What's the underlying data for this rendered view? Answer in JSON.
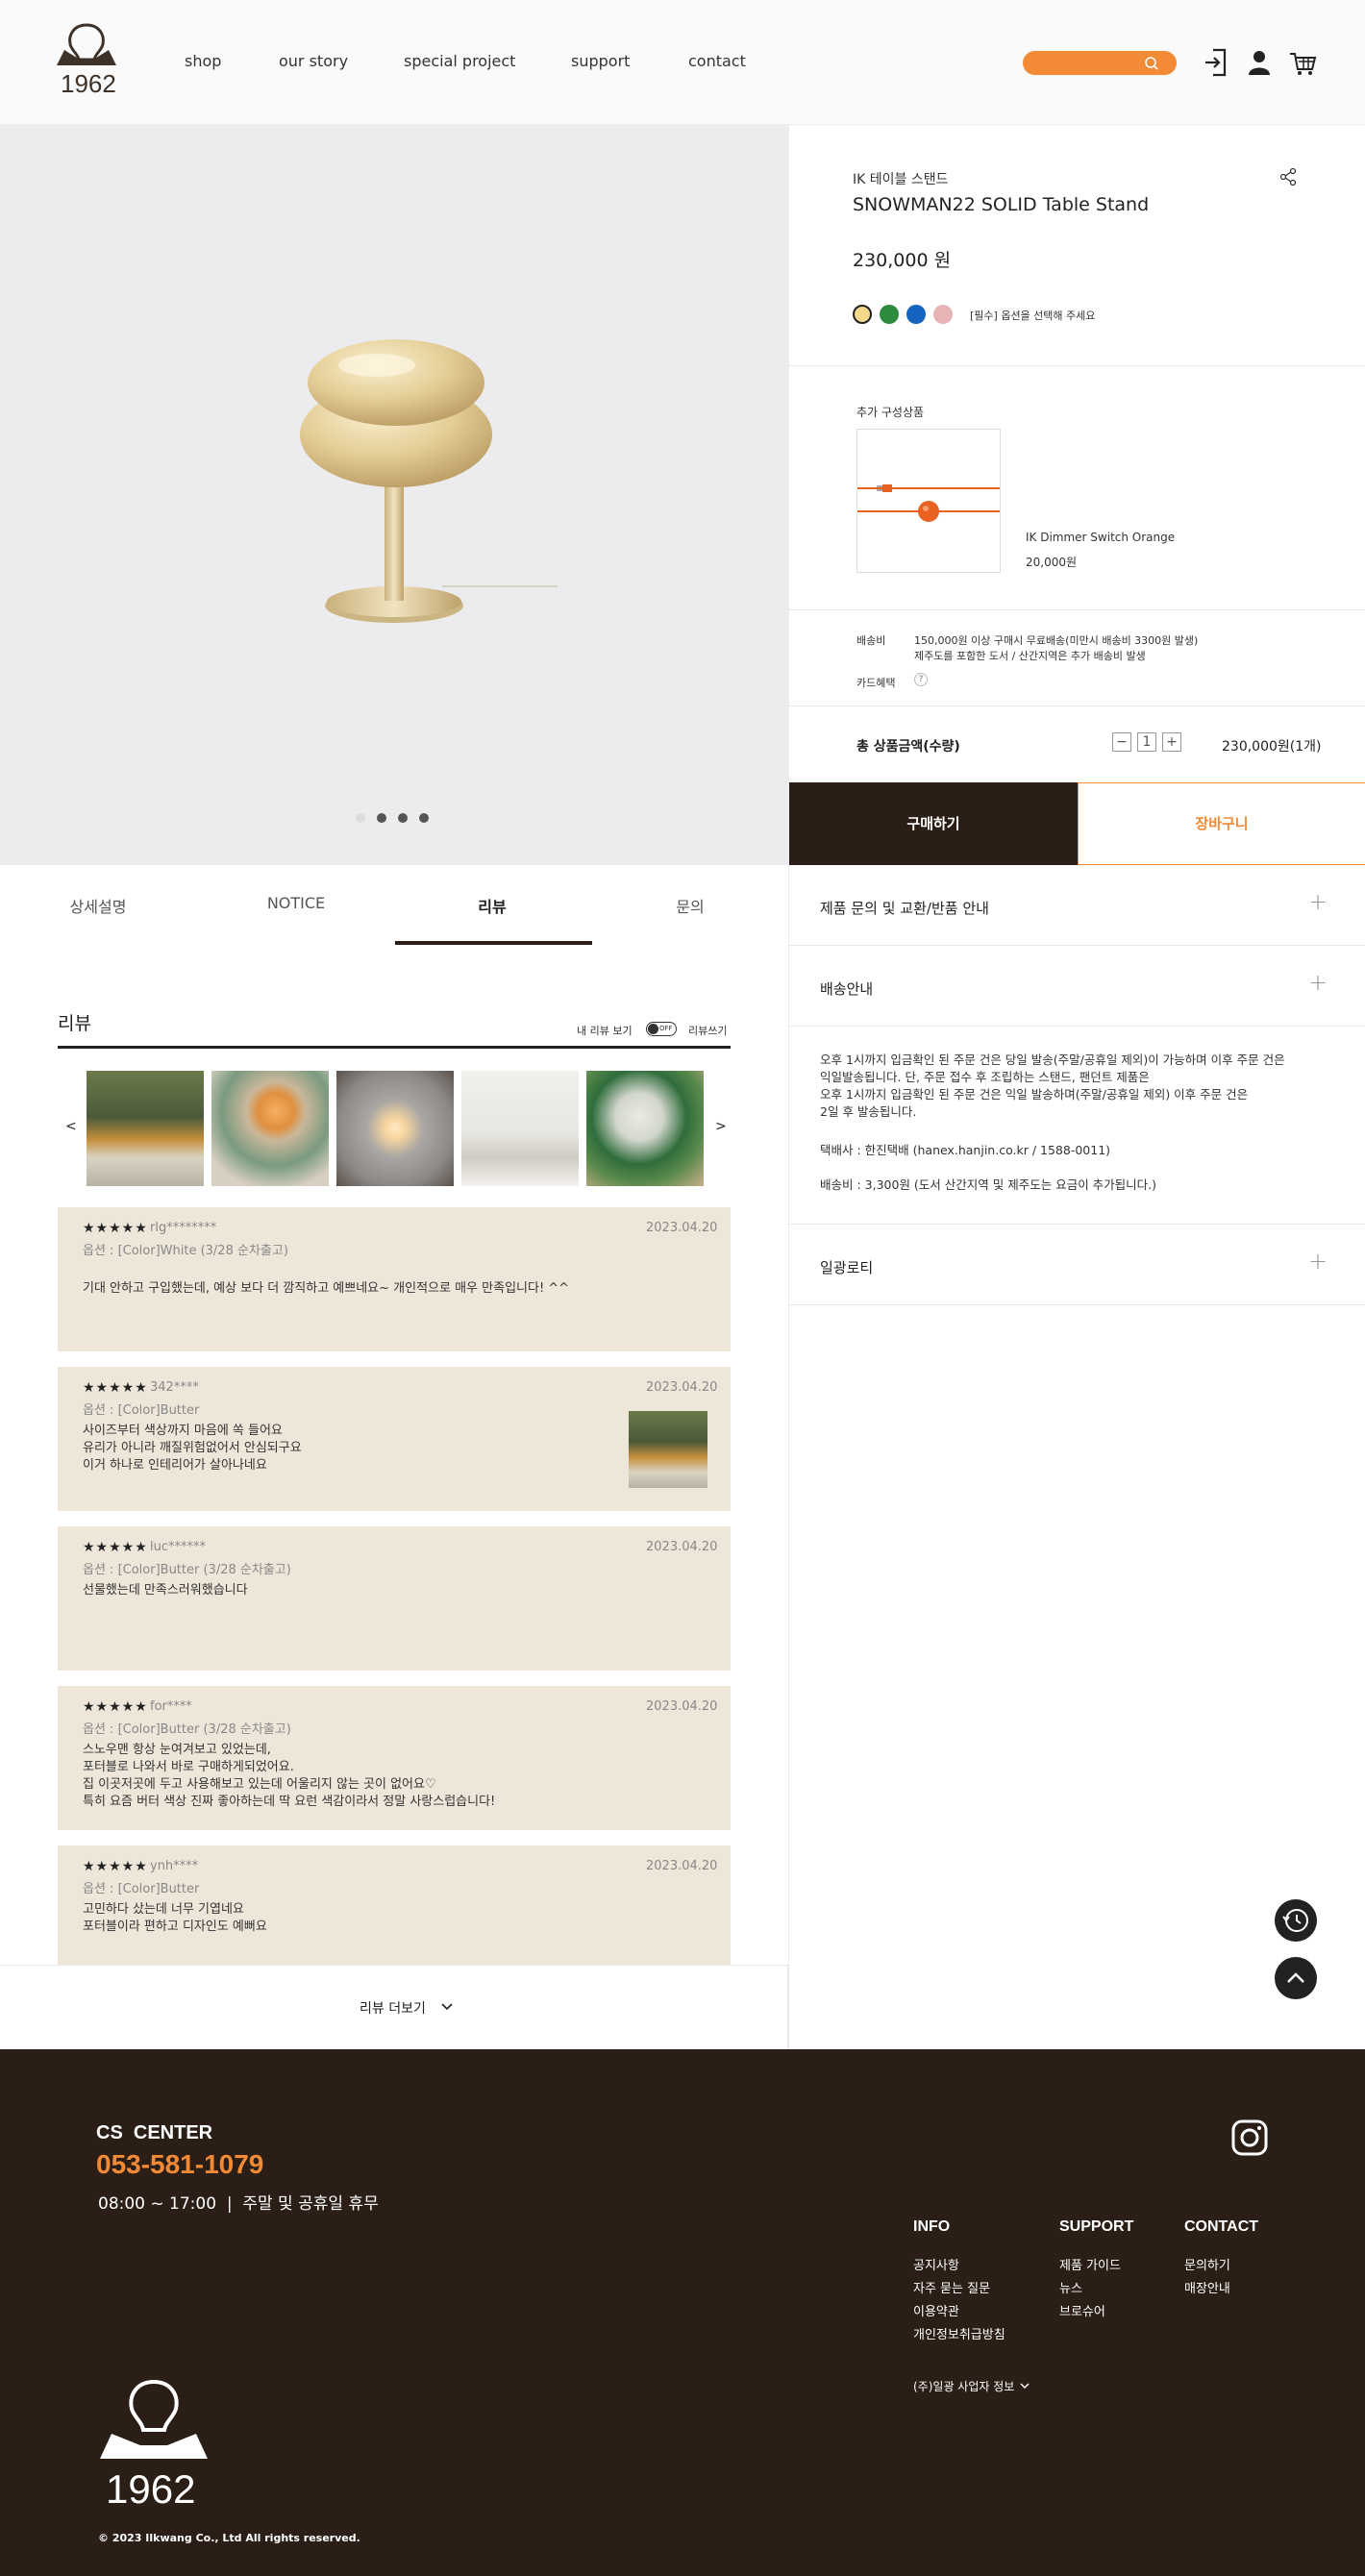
{
  "header": {
    "logo_text": "1962",
    "nav": [
      "shop",
      "our story",
      "special project",
      "support",
      "contact"
    ],
    "icons": [
      "search-icon",
      "login-icon",
      "user-icon",
      "cart-icon"
    ]
  },
  "gallery": {
    "dots": 4,
    "active_dot": 0
  },
  "product": {
    "category": "IK 테이블 스탠드",
    "name": "SNOWMAN22 SOLID Table Stand",
    "price": "230,000 원",
    "colors": [
      "#f5d98a",
      "#2e8b3e",
      "#1565c0",
      "#e6b4b4"
    ],
    "color_hint": "[필수] 옵션을 선택해 주세요",
    "addon_title": "추가 구성상품",
    "addon_name": "IK Dimmer Switch Orange",
    "addon_price": "20,000원",
    "shipping_label": "배송비",
    "shipping_line1": "150,000원 이상 구매시 무료배송(미만시 배송비 3300원 발생)",
    "shipping_line2": "제주도를 포함한 도서 / 산간지역은 추가 배송비 발생",
    "card_label": "카드혜택",
    "total_label": "총 상품금액(수량)",
    "qty": "1",
    "total_value": "230,000원(1개)",
    "buy_label": "구매하기",
    "cart_label": "장바구니"
  },
  "tabs": [
    "상세설명",
    "NOTICE",
    "리뷰",
    "문의"
  ],
  "reviews": {
    "title": "리뷰",
    "my_review": "내 리뷰 보기",
    "toggle": "OFF",
    "write": "리뷰쓰기",
    "prev": "<",
    "next": ">",
    "more": "리뷰 더보기",
    "items": [
      {
        "stars": "★★★★★",
        "name": "rlg********",
        "option": "옵션 : [Color]White (3/28 순차출고)",
        "date": "2023.04.20",
        "text": "기대 안하고 구입했는데, 예상 보다 더 깜직하고 예쁘네요~ 개인적으로 매우 만족입니다! ^^"
      },
      {
        "stars": "★★★★★",
        "name": "342****",
        "option": "옵션 : [Color]Butter",
        "date": "2023.04.20",
        "text": "사이즈부터 색상까지 마음에 쏙 들어요\n유리가 아니라 깨질위험없어서 안심되구요\n이거 하나로 인테리어가 살아나네요"
      },
      {
        "stars": "★★★★★",
        "name": "luc******",
        "option": "옵션 : [Color]Butter (3/28 순차출고)",
        "date": "2023.04.20",
        "text": "선물했는데 만족스러워했습니다"
      },
      {
        "stars": "★★★★★",
        "name": "for****",
        "option": "옵션 : [Color]Butter (3/28 순차출고)",
        "date": "2023.04.20",
        "text": "스노우맨 항상 눈여겨보고 있었는데,\n포터블로 나와서 바로 구매하게되었어요.\n집 이곳저곳에 두고 사용해보고 있는데 어울리지 않는 곳이 없어요♡\n특히 요즘 버터 색상 진짜 좋아하는데 딱 요런 색감이라서 정말 사랑스럽습니다!"
      },
      {
        "stars": "★★★★★",
        "name": "ynh****",
        "option": "옵션 : [Color]Butter",
        "date": "2023.04.20",
        "text": "고민하다 샀는데 너무 기엽네요\n포터블이라 편하고 디자인도 예뻐요"
      }
    ]
  },
  "accordion": {
    "items": [
      "제품 문의 및 교환/반품 안내",
      "배송안내",
      "일광로티"
    ],
    "shipping_text": "오후 1시까지 입금확인 된 주문 건은 당일 발송(주말/공휴일 제외)이 가능하며 이후 주문 건은\n익일발송됩니다. 단, 주문 접수 후 조립하는 스탠드, 팬던트 제품은\n오후 1시까지 입금확인 된 주문 건은 익일 발송하며(주말/공휴일 제외) 이후 주문 건은\n2일 후 발송됩니다.",
    "courier": "택배사 : 한진택배 (hanex.hanjin.co.kr / 1588-0011)",
    "fee": "배송비 : 3,300원 (도서 산간지역 및 제주도는 요금이 추가됩니다.)"
  },
  "footer": {
    "cs_title": "CS  CENTER",
    "phone": "053-581-1079",
    "hours": "08:00 ~ 17:00  |  주말 및 공휴일 휴무",
    "logo_text": "1962",
    "copyright": "© 2023 Ilkwang Co., Ltd All rights reserved.",
    "cols": [
      {
        "title": "INFO",
        "links": [
          "공지사항",
          "자주 묻는 질문",
          "이용약관",
          "개인정보취급방침"
        ]
      },
      {
        "title": "SUPPORT",
        "links": [
          "제품 가이드",
          "뉴스",
          "브로슈어"
        ]
      },
      {
        "title": "CONTACT",
        "links": [
          "문의하기",
          "매장안내"
        ]
      }
    ],
    "company_info": "(주)일광 사업자 정보"
  }
}
